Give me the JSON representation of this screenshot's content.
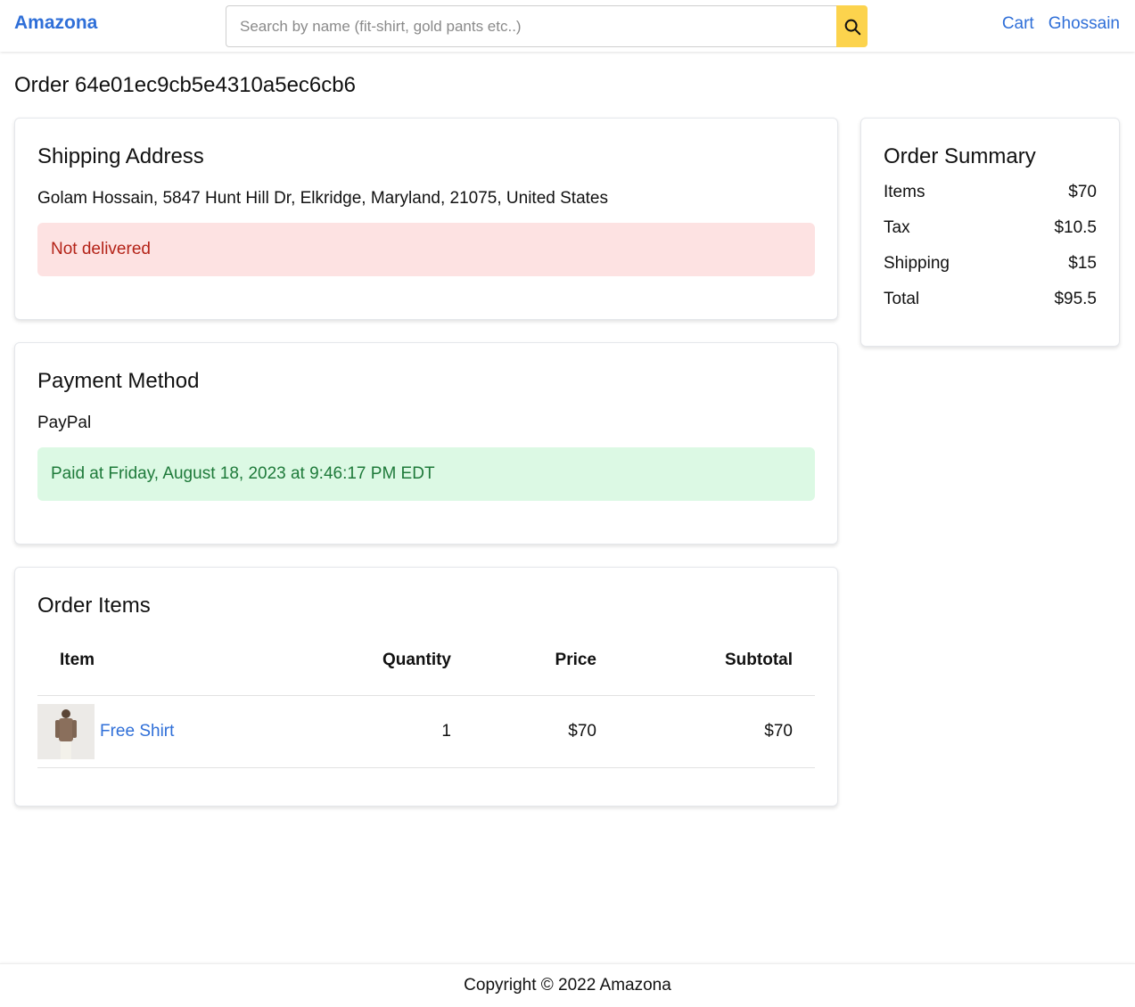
{
  "header": {
    "brand": "Amazona",
    "search": {
      "placeholder": "Search by name (fit-shirt, gold pants etc..)",
      "value": ""
    },
    "nav": {
      "cart": "Cart",
      "user": "Ghossain"
    }
  },
  "page": {
    "title": "Order 64e01ec9cb5e4310a5ec6cb6"
  },
  "shipping": {
    "heading": "Shipping Address",
    "address": "Golam Hossain, 5847 Hunt Hill Dr, Elkridge, Maryland, 21075, United States",
    "status": "Not delivered"
  },
  "payment": {
    "heading": "Payment Method",
    "method": "PayPal",
    "status": "Paid at Friday, August 18, 2023 at 9:46:17 PM EDT"
  },
  "items": {
    "heading": "Order Items",
    "columns": {
      "item": "Item",
      "quantity": "Quantity",
      "price": "Price",
      "subtotal": "Subtotal"
    },
    "rows": [
      {
        "name": "Free Shirt",
        "quantity": "1",
        "price": "$70",
        "subtotal": "$70"
      }
    ]
  },
  "summary": {
    "heading": "Order Summary",
    "items_label": "Items",
    "items_value": "$70",
    "tax_label": "Tax",
    "tax_value": "$10.5",
    "shipping_label": "Shipping",
    "shipping_value": "$15",
    "total_label": "Total",
    "total_value": "$95.5"
  },
  "footer": {
    "copyright": "Copyright © 2022 Amazona"
  },
  "colors": {
    "link": "#2f6fd8",
    "search_button": "#fcd34d",
    "error_bg": "#fde2e2",
    "success_bg": "#dcf9e4"
  },
  "icons": {
    "search": "search-icon"
  }
}
